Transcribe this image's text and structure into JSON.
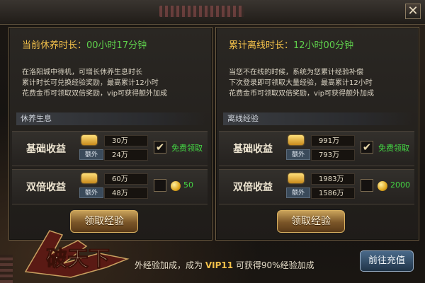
{
  "header": {
    "close_symbol": "✕"
  },
  "left_panel": {
    "title_label": "当前休养时长：",
    "title_value": "00小时17分钟",
    "desc_lines": [
      "在洛阳城中待机，可增长休养生息时长",
      "累计时长可兑换经验奖励，最高累计12小时",
      "花费金币可领取双倍奖励，vip可获得额外加成"
    ],
    "section_label": "休养生息",
    "basic": {
      "label": "基础收益",
      "base": "30万",
      "extra_tag": "额外",
      "extra": "24万",
      "checked": true,
      "check_symbol": "✔",
      "action": "免费领取"
    },
    "double": {
      "label": "双倍收益",
      "base": "60万",
      "extra_tag": "额外",
      "extra": "48万",
      "checked": false,
      "cost": "50"
    },
    "claim_button": "领取经验"
  },
  "right_panel": {
    "title_label": "累计离线时长：",
    "title_value": "12小时00分钟",
    "desc_lines": [
      "当您不在线的时候，系统为您累计经验补偿",
      "下次登录即可领取大量经验，最高累计12小时",
      "花费金币可领取双倍奖励，vip可获得额外加成"
    ],
    "section_label": "离线经验",
    "basic": {
      "label": "基础收益",
      "base": "991万",
      "extra_tag": "额外",
      "extra": "793万",
      "checked": true,
      "check_symbol": "✔",
      "action": "免费领取"
    },
    "double": {
      "label": "双倍收益",
      "base": "1983万",
      "extra_tag": "额外",
      "extra": "1586万",
      "checked": false,
      "cost": "2000"
    },
    "claim_button": "领取经验"
  },
  "footer": {
    "text_prefix": "外经验加成，成为 ",
    "vip": "VIP11",
    "text_suffix": " 可获得90%经验加成",
    "goto_button": "前往充值"
  },
  "logo_text": "破天下",
  "colors": {
    "gold": "#f2c04a",
    "green": "#44d844"
  }
}
